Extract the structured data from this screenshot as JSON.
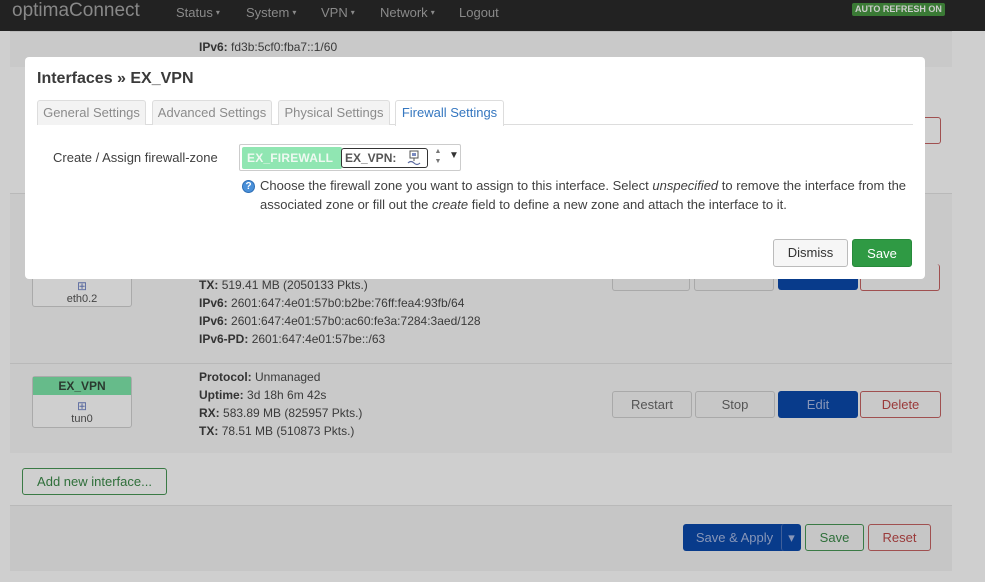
{
  "navbar": {
    "brand": "optimaConnect",
    "items": [
      {
        "label": "Status",
        "caret": "▾"
      },
      {
        "label": "System",
        "caret": "▾"
      },
      {
        "label": "VPN",
        "caret": "▾"
      },
      {
        "label": "Network",
        "caret": "▾"
      },
      {
        "label": "Logout",
        "caret": ""
      }
    ],
    "auto_refresh": "AUTO REFRESH ON"
  },
  "background": {
    "top_partial": {
      "ipv6_label": "IPv6:",
      "ipv6_value": "fd3b:5cf0:fba7::1/60"
    },
    "wan6": {
      "device": "eth0.2",
      "tx_label": "TX:",
      "tx_value": "519.41 MB (2050133 Pkts.)",
      "ipv6_1_label": "IPv6:",
      "ipv6_1_value": "2601:647:4e01:57b0:b2be:76ff:fea4:93fb/64",
      "ipv6_2_label": "IPv6:",
      "ipv6_2_value": "2601:647:4e01:57b0:ac60:fe3a:7284:3aed/128",
      "ipv6pd_label": "IPv6-PD:",
      "ipv6pd_value": "2601:647:4e01:57be::/63"
    },
    "ex_vpn": {
      "name": "EX_VPN",
      "device": "tun0",
      "protocol_label": "Protocol:",
      "protocol_value": "Unmanaged",
      "uptime_label": "Uptime:",
      "uptime_value": "3d 18h 6m 42s",
      "rx_label": "RX:",
      "rx_value": "583.89 MB (825957 Pkts.)",
      "tx_label": "TX:",
      "tx_value": "78.51 MB (510873 Pkts.)",
      "restart": "Restart",
      "stop": "Stop",
      "edit": "Edit",
      "delete": "Delete"
    },
    "add_interface": "Add new interface...",
    "footer": {
      "save_apply": "Save & Apply",
      "save": "Save",
      "reset": "Reset"
    }
  },
  "modal": {
    "title": "Interfaces » EX_VPN",
    "tabs": [
      "General Settings",
      "Advanced Settings",
      "Physical Settings",
      "Firewall Settings"
    ],
    "active_tab": "Firewall Settings",
    "field_label": "Create / Assign firewall-zone",
    "zone_selected": "EX_FIREWALL",
    "zone_network": "EX_VPN:",
    "help": {
      "part1": "Choose the firewall zone you want to assign to this interface. Select ",
      "em1": "unspecified",
      "part2": " to remove the interface from the associated zone or fill out the ",
      "em2": "create",
      "part3": " field to define a new zone and attach the interface to it."
    },
    "dismiss": "Dismiss",
    "save": "Save"
  },
  "colors": {
    "zone_green": "#90e6b2",
    "primary_blue": "#0d5dcf",
    "save_green": "#2f9a44"
  }
}
